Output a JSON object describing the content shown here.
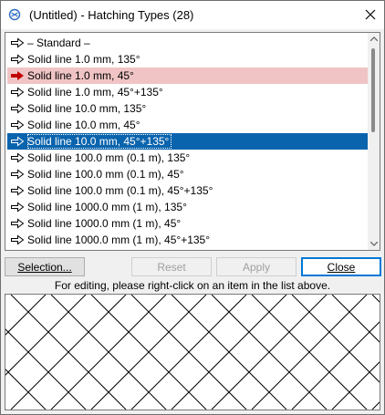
{
  "window": {
    "title": "(Untitled) - Hatching Types (28)",
    "icons": {
      "app": "hatch-app-icon",
      "close": "close-icon"
    }
  },
  "list": {
    "items": [
      {
        "label": "– Standard –",
        "icon": "outline-arrow-icon",
        "state": "normal"
      },
      {
        "label": "Solid line 1.0 mm, 135°",
        "icon": "outline-arrow-icon",
        "state": "normal"
      },
      {
        "label": "Solid line 1.0 mm, 45°",
        "icon": "red-arrow-icon",
        "state": "current"
      },
      {
        "label": "Solid line 1.0 mm, 45°+135°",
        "icon": "outline-arrow-icon",
        "state": "normal"
      },
      {
        "label": "Solid line 10.0 mm, 135°",
        "icon": "outline-arrow-icon",
        "state": "normal"
      },
      {
        "label": "Solid line 10.0 mm, 45°",
        "icon": "outline-arrow-icon",
        "state": "normal"
      },
      {
        "label": "Solid line 10.0 mm, 45°+135°",
        "icon": "outline-arrow-icon",
        "state": "selected"
      },
      {
        "label": "Solid line 100.0 mm (0.1 m), 135°",
        "icon": "outline-arrow-icon",
        "state": "normal"
      },
      {
        "label": "Solid line 100.0 mm (0.1 m), 45°",
        "icon": "outline-arrow-icon",
        "state": "normal"
      },
      {
        "label": "Solid line 100.0 mm (0.1 m), 45°+135°",
        "icon": "outline-arrow-icon",
        "state": "normal"
      },
      {
        "label": "Solid line 1000.0 mm (1 m), 135°",
        "icon": "outline-arrow-icon",
        "state": "normal"
      },
      {
        "label": "Solid line 1000.0 mm (1 m), 45°",
        "icon": "outline-arrow-icon",
        "state": "normal"
      },
      {
        "label": "Solid line 1000.0 mm (1 m), 45°+135°",
        "icon": "outline-arrow-icon",
        "state": "normal"
      }
    ],
    "colors": {
      "selected_bg": "#0a64ad",
      "current_bg": "#f0c4c4",
      "current_arrow": "#c00000"
    }
  },
  "buttons": {
    "selection": {
      "label": "Selection...",
      "enabled": true
    },
    "reset": {
      "label": "Reset",
      "enabled": false
    },
    "apply": {
      "label": "Apply",
      "enabled": false
    },
    "close": {
      "label": "Close",
      "enabled": true,
      "default": true
    }
  },
  "hint": "For editing, please right-click on an item in the list above.",
  "preview": {
    "pattern": "crosshatch 45°+135°"
  }
}
